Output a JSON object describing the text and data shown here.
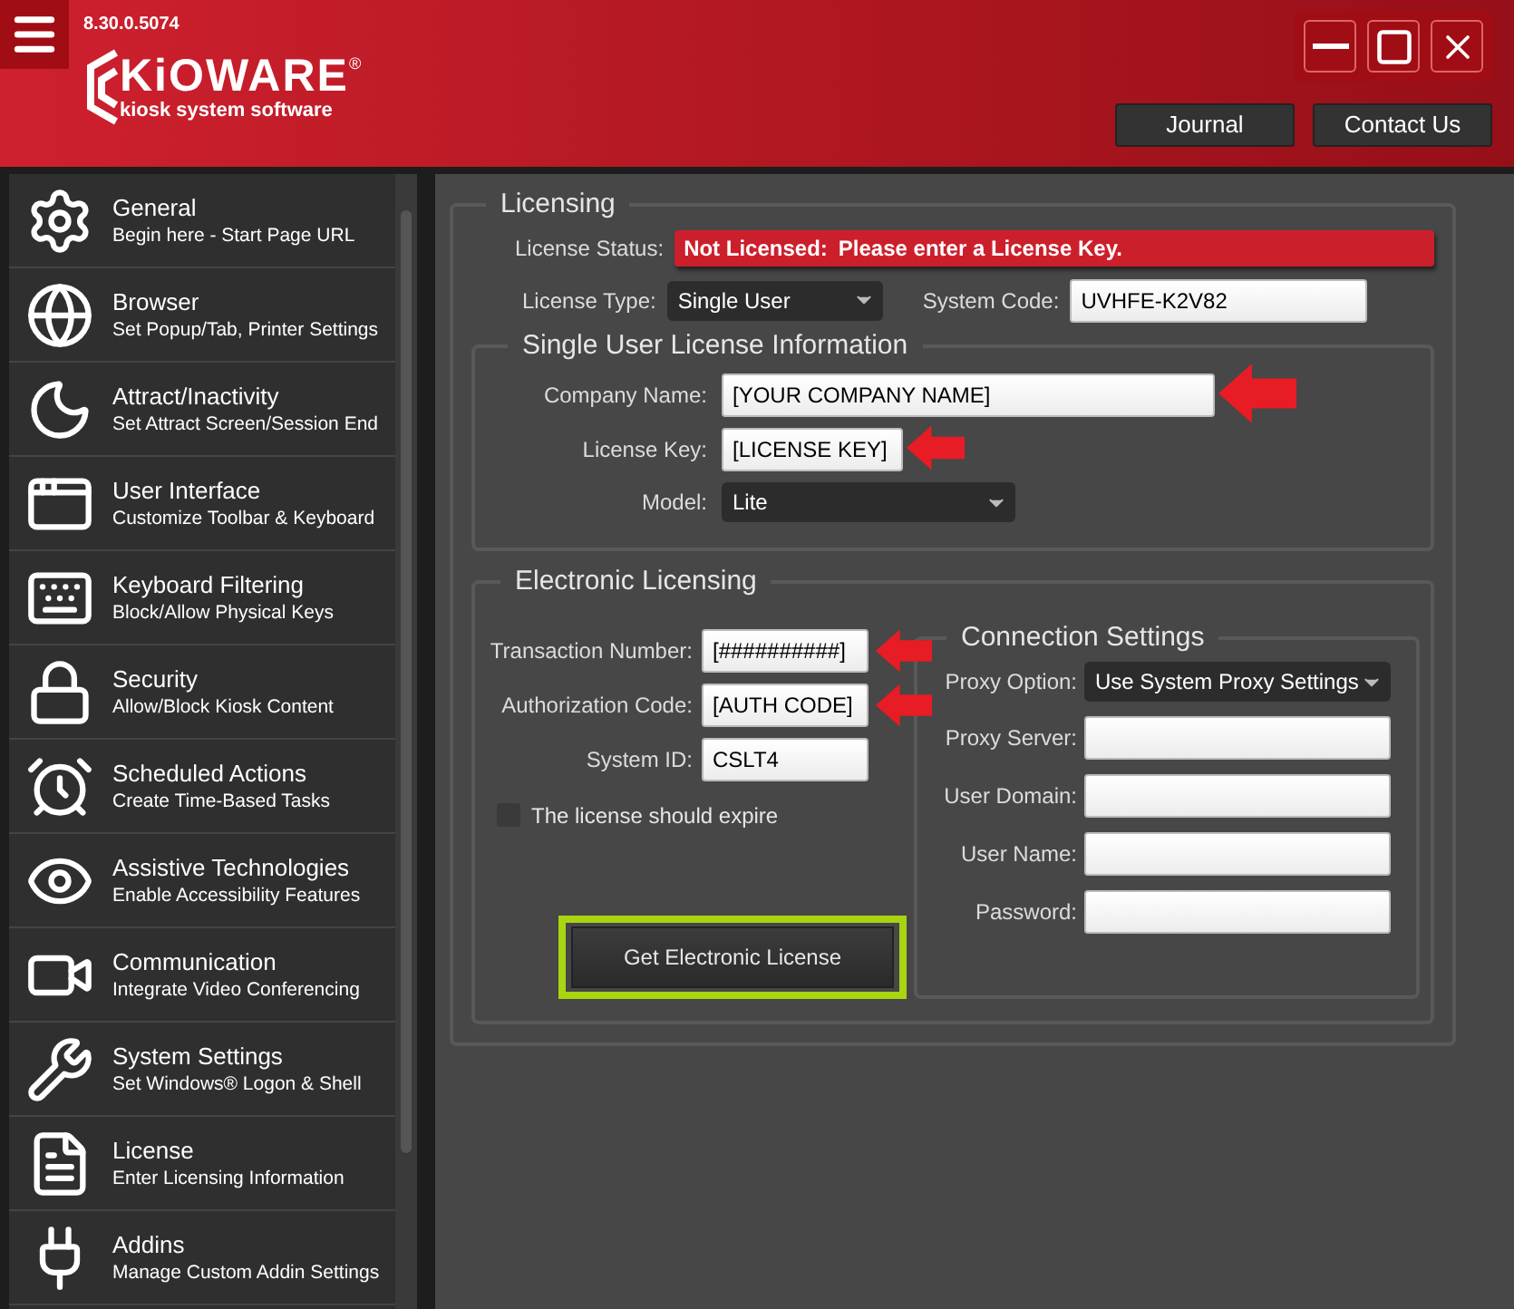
{
  "header": {
    "version": "8.30.0.5074",
    "logo_text": "KiOWARE",
    "logo_mark": "®",
    "tagline": "kiosk system software",
    "buttons": [
      "Journal",
      "Contact Us"
    ]
  },
  "sidebar": {
    "items": [
      {
        "title": "General",
        "subtitle": "Begin here - Start Page URL"
      },
      {
        "title": "Browser",
        "subtitle": "Set Popup/Tab, Printer Settings"
      },
      {
        "title": "Attract/Inactivity",
        "subtitle": "Set Attract Screen/Session End"
      },
      {
        "title": "User Interface",
        "subtitle": "Customize Toolbar & Keyboard"
      },
      {
        "title": "Keyboard Filtering",
        "subtitle": "Block/Allow Physical Keys"
      },
      {
        "title": "Security",
        "subtitle": "Allow/Block Kiosk Content"
      },
      {
        "title": "Scheduled Actions",
        "subtitle": "Create Time-Based Tasks"
      },
      {
        "title": "Assistive Technologies",
        "subtitle": "Enable Accessibility Features"
      },
      {
        "title": "Communication",
        "subtitle": "Integrate Video Conferencing"
      },
      {
        "title": "System Settings",
        "subtitle": "Set Windows® Logon & Shell"
      },
      {
        "title": "License",
        "subtitle": "Enter Licensing Information"
      },
      {
        "title": "Addins",
        "subtitle": "Manage Custom Addin Settings"
      }
    ]
  },
  "licensing": {
    "title": "Licensing",
    "status_label": "License Status:",
    "status_prefix": "Not Licensed:",
    "status_message": "Please enter a License Key.",
    "type_label": "License Type:",
    "type_value": "Single User",
    "system_code_label": "System Code:",
    "system_code_value": "UVHFE-K2V82",
    "single_user": {
      "title": "Single User License Information",
      "company_label": "Company Name:",
      "company_value": "[YOUR COMPANY NAME]",
      "key_label": "License Key:",
      "key_value": "[LICENSE KEY]",
      "model_label": "Model:",
      "model_value": "Lite"
    },
    "electronic": {
      "title": "Electronic Licensing",
      "transaction_label": "Transaction Number:",
      "transaction_value": "[##########]",
      "auth_label": "Authorization Code:",
      "auth_value": "[AUTH CODE]",
      "system_id_label": "System ID:",
      "system_id_value": "CSLT4",
      "expire_label": "The license should expire",
      "expire_checked": false,
      "button": "Get Electronic License",
      "connection": {
        "title": "Connection Settings",
        "proxy_option_label": "Proxy Option:",
        "proxy_option_value": "Use System Proxy Settings",
        "fields": [
          "Proxy Server:",
          "User Domain:",
          "User Name:",
          "Password:"
        ]
      }
    }
  }
}
